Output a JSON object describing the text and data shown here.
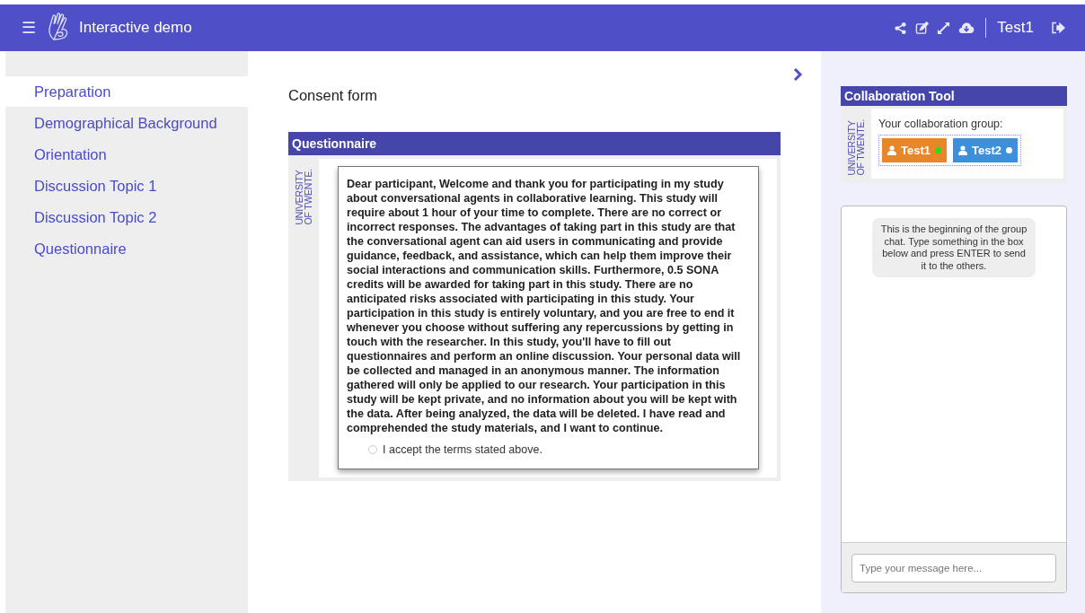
{
  "header": {
    "menu_icon": "☰",
    "title": "Interactive demo",
    "user": "Test1"
  },
  "sidebar": {
    "items": [
      {
        "label": "Preparation",
        "selected": true
      },
      {
        "label": "Demographical Background",
        "selected": false
      },
      {
        "label": "Orientation",
        "selected": false
      },
      {
        "label": "Discussion Topic 1",
        "selected": false
      },
      {
        "label": "Discussion Topic 2",
        "selected": false
      },
      {
        "label": "Questionnaire",
        "selected": false
      }
    ]
  },
  "main": {
    "title": "Consent form",
    "card": {
      "title": "Questionnaire",
      "logo": [
        "UNIVERSITY",
        "OF TWENTE."
      ],
      "text": "Dear participant, Welcome and thank you for participating in my study about conversational agents in collaborative learning. This study will require about 1 hour of your time to complete. There are no correct or incorrect responses. The advantages of taking part in this study are that the conversational agent can aid users in communicating and provide guidance, feedback, and assistance, which can help them improve their social interactions and communication skills. Furthermore, 0.5 SONA credits will be awarded for taking part in this study. There are no anticipated risks associated with participating in this study. Your participation in this study is entirely voluntary, and you are free to end it whenever you choose without suffering any repercussions by getting in touch with the researcher. In this study, you'll have to fill out questionnaires and perform an online discussion. Your personal data will be collected and managed in an anonymous manner. The information gathered will only be applied to our research. Your participation in this study will be kept private, and no information about you will be kept with the data. After being analyzed, the data will be deleted. I have read and comprehended the study materials, and I want to continue.",
      "consent": {
        "label": "I accept the terms stated above.",
        "checked": false
      }
    }
  },
  "collaboration": {
    "title": "Collaboration Tool",
    "logo": [
      "UNIVERSITY",
      "OF TWENTE."
    ],
    "group_label": "Your collaboration group:",
    "members": [
      {
        "name": "Test1",
        "color": "#e8862a",
        "online": true
      },
      {
        "name": "Test2",
        "color": "#3d8fdb",
        "online": false
      }
    ]
  },
  "chat": {
    "system_message": "This is the beginning of the group chat. Type something in the box below and press ENTER to send it to the others.",
    "placeholder": "Type your message here..."
  }
}
